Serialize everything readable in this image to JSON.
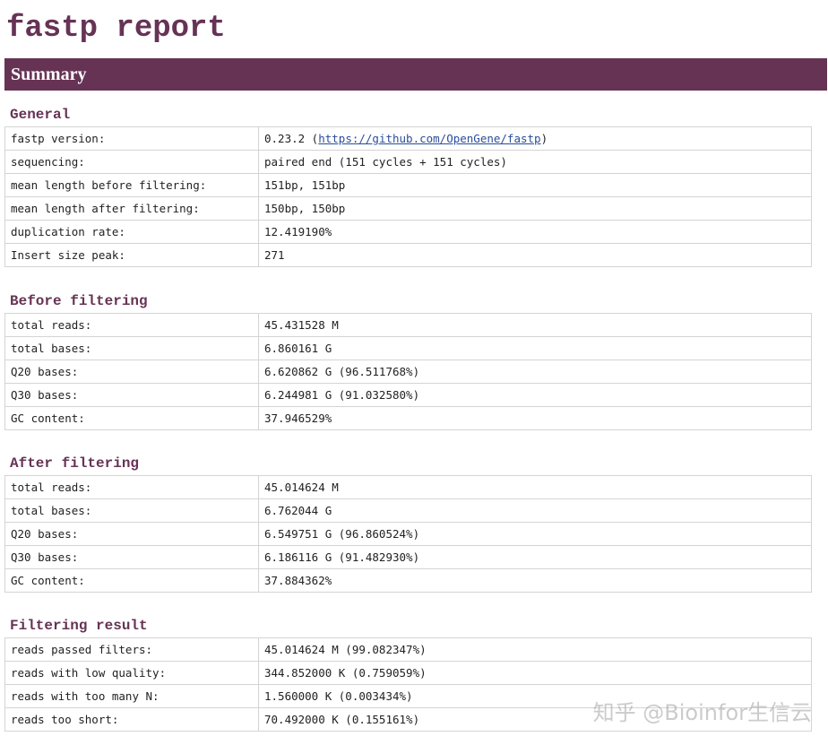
{
  "page_title": "fastp report",
  "summary_label": "Summary",
  "general": {
    "title": "General",
    "rows": [
      {
        "key": "fastp version:",
        "value": "0.23.2 (",
        "link": "https://github.com/OpenGene/fastp",
        "suffix": ")"
      },
      {
        "key": "sequencing:",
        "value": "paired end (151 cycles + 151 cycles)"
      },
      {
        "key": "mean length before filtering:",
        "value": "151bp, 151bp"
      },
      {
        "key": "mean length after filtering:",
        "value": "150bp, 150bp"
      },
      {
        "key": "duplication rate:",
        "value": "12.419190%"
      },
      {
        "key": "Insert size peak:",
        "value": "271"
      }
    ]
  },
  "before": {
    "title": "Before filtering",
    "rows": [
      {
        "key": "total reads:",
        "value": "45.431528 M"
      },
      {
        "key": "total bases:",
        "value": "6.860161 G"
      },
      {
        "key": "Q20 bases:",
        "value": "6.620862 G (96.511768%)"
      },
      {
        "key": "Q30 bases:",
        "value": "6.244981 G (91.032580%)"
      },
      {
        "key": "GC content:",
        "value": "37.946529%"
      }
    ]
  },
  "after": {
    "title": "After filtering",
    "rows": [
      {
        "key": "total reads:",
        "value": "45.014624 M"
      },
      {
        "key": "total bases:",
        "value": "6.762044 G"
      },
      {
        "key": "Q20 bases:",
        "value": "6.549751 G (96.860524%)"
      },
      {
        "key": "Q30 bases:",
        "value": "6.186116 G (91.482930%)"
      },
      {
        "key": "GC content:",
        "value": "37.884362%"
      }
    ]
  },
  "filtering": {
    "title": "Filtering result",
    "rows": [
      {
        "key": "reads passed filters:",
        "value": "45.014624 M (99.082347%)"
      },
      {
        "key": "reads with low quality:",
        "value": "344.852000 K (0.759059%)"
      },
      {
        "key": "reads with too many N:",
        "value": "1.560000 K (0.003434%)"
      },
      {
        "key": "reads too short:",
        "value": "70.492000 K (0.155161%)"
      }
    ]
  },
  "watermark": "知乎 @Bioinfor生信云",
  "colors": {
    "accent": "#663355",
    "link": "#2a4d9c",
    "border": "#d4d4d4"
  }
}
